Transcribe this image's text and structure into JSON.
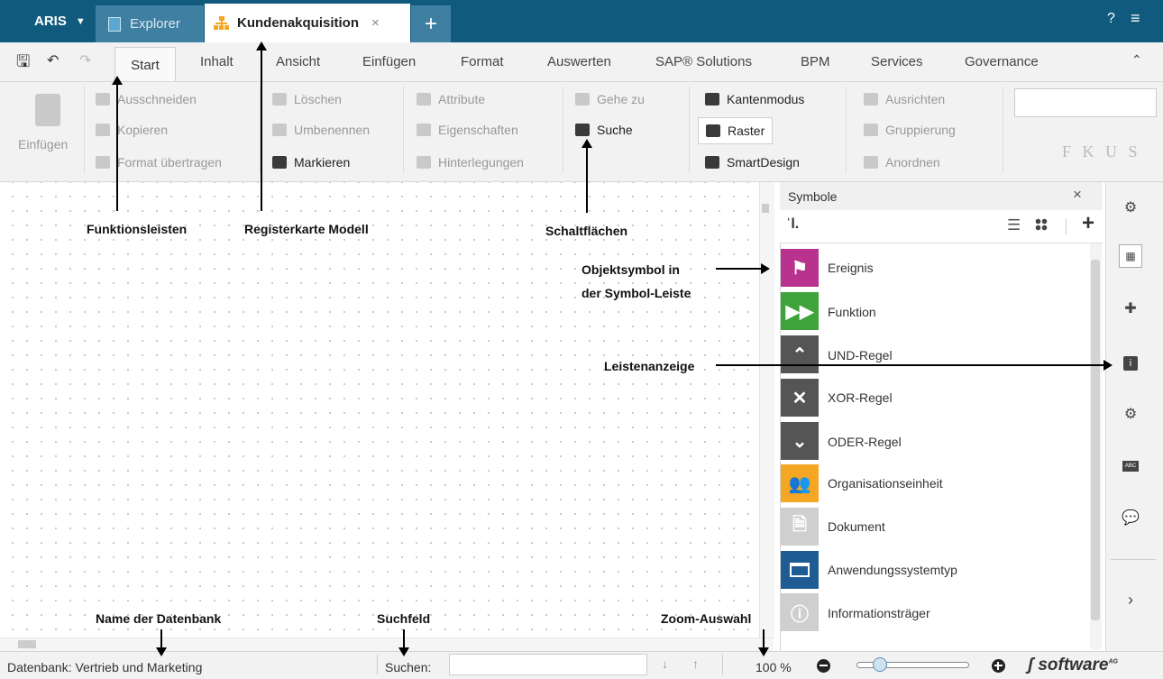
{
  "topbar": {
    "app_label": "ARIS",
    "tab_explorer": "Explorer",
    "tab_model": "Kundenakquisition",
    "tab_close": "×",
    "add_tab": "+",
    "help": "?",
    "menu": "≡"
  },
  "ribbon_tabs": [
    "Start",
    "Inhalt",
    "Ansicht",
    "Einfügen",
    "Format",
    "Auswerten",
    "SAP® Solutions",
    "BPM",
    "Services",
    "Governance"
  ],
  "ribbon": {
    "einfuegen": "Einfügen",
    "ausschneiden": "Ausschneiden",
    "kopieren": "Kopieren",
    "format_uebertragen": "Format übertragen",
    "loeschen": "Löschen",
    "umbenennen": "Umbenennen",
    "markieren": "Markieren",
    "attribute": "Attribute",
    "eigenschaften": "Eigenschaften",
    "hinterlegungen": "Hinterlegungen",
    "gehe_zu": "Gehe zu",
    "suche": "Suche",
    "kantenmodus": "Kantenmodus",
    "raster": "Raster",
    "smartdesign": "SmartDesign",
    "ausrichten": "Ausrichten",
    "gruppierung": "Gruppierung",
    "anordnen": "Anordnen",
    "font_style": "F  K  U  S"
  },
  "symbol_panel": {
    "title": "Symbole",
    "close": "×",
    "items": [
      {
        "label": "Ereignis",
        "color": "#b7338e"
      },
      {
        "label": "Funktion",
        "color": "#3ea33a"
      },
      {
        "label": "UND-Regel",
        "color": "#555555"
      },
      {
        "label": "XOR-Regel",
        "color": "#555555"
      },
      {
        "label": "ODER-Regel",
        "color": "#555555"
      },
      {
        "label": "Organisationseinheit",
        "color": "#f5a623"
      },
      {
        "label": "Dokument",
        "color": "#cfcfcf"
      },
      {
        "label": "Anwendungssystemtyp",
        "color": "#1f5c94"
      },
      {
        "label": "Informationsträger",
        "color": "#cfcfcf"
      }
    ]
  },
  "status": {
    "database": "Datenbank: Vertrieb und Marketing",
    "search_label": "Suchen:",
    "zoom": "100 %",
    "brand": "software"
  },
  "annotations": {
    "funktionsleisten": "Funktionsleisten",
    "registerkarte": "Registerkarte Modell",
    "schaltflaechen": "Schaltflächen",
    "objektsymbol_1": "Objektsymbol in",
    "objektsymbol_2": "der Symbol-Leiste",
    "leistenanzeige": "Leistenanzeige",
    "name_db": "Name der Datenbank",
    "suchfeld": "Suchfeld",
    "zoom_auswahl": "Zoom-Auswahl"
  }
}
